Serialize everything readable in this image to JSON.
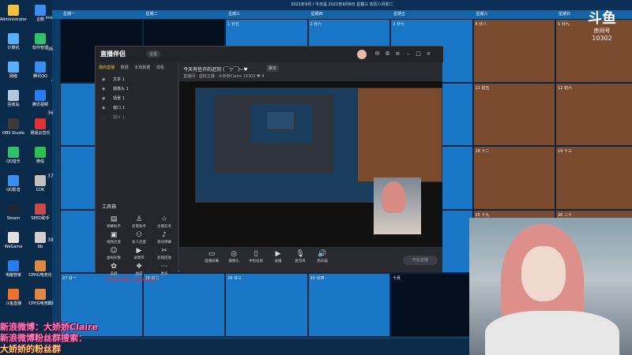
{
  "desktop_icons": [
    {
      "label": "Administrator",
      "color": "#f0c040"
    },
    {
      "label": "企鹅",
      "color": "#3b8df0"
    },
    {
      "label": "计算机",
      "color": "#5ab0ff"
    },
    {
      "label": "软件管理",
      "color": "#33c06a"
    },
    {
      "label": "网络",
      "color": "#5ab0ff"
    },
    {
      "label": "腾讯QQ",
      "color": "#3b8df0"
    },
    {
      "label": "回收站",
      "color": "#b0c8e0"
    },
    {
      "label": "腾讯视频",
      "color": "#2a7bf0"
    },
    {
      "label": "OBS Studio",
      "color": "#3a3a3a"
    },
    {
      "label": "网易云音乐",
      "color": "#d33"
    },
    {
      "label": "QQ音乐",
      "color": "#33c06a"
    },
    {
      "label": "微信",
      "color": "#2fbf55"
    },
    {
      "label": "QQ影音",
      "color": "#3b8df0"
    },
    {
      "label": "CDK",
      "color": "#c0c0c0"
    },
    {
      "label": "Steam",
      "color": "#1b2838"
    },
    {
      "label": "SEED助手",
      "color": "#c84a4a"
    },
    {
      "label": "WeGame",
      "color": "#e0e0e0"
    },
    {
      "label": "bb",
      "color": "#d0d0d0"
    },
    {
      "label": "电脑管家",
      "color": "#2a7bf0"
    },
    {
      "label": "CPHG电竞化",
      "color": "#d84"
    },
    {
      "label": "斗鱼直播",
      "color": "#f07030"
    },
    {
      "label": "CPHG电竞化",
      "color": "#d84"
    }
  ],
  "desktop_icons2": [
    {
      "label": "Internet Explorer",
      "color": "#3b8df0"
    },
    {
      "label": "LABELPRINT",
      "color": "#3a6ac0"
    },
    {
      "label": "Office2007",
      "color": "#d04a2a"
    },
    {
      "label": "QQ浏览器",
      "color": "#3b8df0"
    },
    {
      "label": "QQ游戏",
      "color": "#3b8df0"
    },
    {
      "label": "YY开播",
      "color": "#f0c040"
    },
    {
      "label": "小火箭",
      "color": "#f07030"
    },
    {
      "label": "网络上传",
      "color": "#5ab0ff"
    },
    {
      "label": "虎牙直播",
      "color": "#f0c040"
    },
    {
      "label": "直播伴侣",
      "color": "#d04a2a"
    }
  ],
  "calendar": {
    "topbar": "2021年9月 / 今天是 2021年9月8日 星期三 农历八月初二",
    "weekdays": [
      "星期一",
      "星期二",
      "星期三",
      "星期四",
      "星期五",
      "星期六",
      "星期日"
    ],
    "row_labels": [
      "35",
      "36",
      "37",
      "38",
      "39"
    ],
    "cells": [
      {
        "row": 0,
        "col": 2,
        "text": "1 廿五"
      },
      {
        "row": 0,
        "col": 3,
        "text": "2 廿六"
      },
      {
        "row": 0,
        "col": 4,
        "text": "3 廿七"
      },
      {
        "row": 0,
        "col": 5,
        "text": "4 廿八"
      },
      {
        "row": 0,
        "col": 6,
        "text": "5 廿九"
      },
      {
        "row": 1,
        "col": 5,
        "text": "11 初五"
      },
      {
        "row": 1,
        "col": 6,
        "text": "12 初六"
      },
      {
        "row": 2,
        "col": 5,
        "text": "18 十二"
      },
      {
        "row": 2,
        "col": 6,
        "text": "19 十三"
      },
      {
        "row": 3,
        "col": 5,
        "text": "25 十九"
      },
      {
        "row": 3,
        "col": 6,
        "text": "26 二十"
      },
      {
        "row": 4,
        "col": 0,
        "text": "27 廿一"
      },
      {
        "row": 4,
        "col": 1,
        "text": "28 廿二"
      },
      {
        "row": 4,
        "col": 2,
        "text": "29 廿三"
      },
      {
        "row": 4,
        "col": 3,
        "text": "30 廿四"
      },
      {
        "row": 4,
        "col": 4,
        "text": "十月"
      }
    ]
  },
  "room": {
    "logo": "斗鱼",
    "label": "房间号",
    "number": "10302"
  },
  "app": {
    "name": "直播伴侣",
    "version": "设置",
    "left_tabs": [
      "我的直播",
      "数据",
      "本场数据",
      "观看"
    ],
    "scenes": [
      "文本 1",
      "摄像头 1",
      "场景 1",
      "窗口 1",
      "图片 1"
    ],
    "tools_title": "工具箱",
    "tools": [
      "弹幕助手",
      "房管助手",
      "主播任务",
      "视频连麦",
      "多人连麦",
      "歌词弹幕",
      "虚拟形象",
      "录像带",
      "剪辑回放",
      "美颜",
      "福袋",
      "更多"
    ],
    "footer_note": "如何更好的吸引粉丝观看直播？",
    "stream_title": "今天有些许的迟到 (￣▽￣)~♥",
    "stream_tag": "聊天",
    "stream_meta": "直播间 · 虚拟主播 · 大娇娇Claire   10302   ♥ 4",
    "controls": [
      "直播屏幕",
      "摄像头",
      "手机投屏",
      "录播",
      "麦克风",
      "扬声器"
    ],
    "start_live": "开始直播"
  },
  "overlay": {
    "line1": "新浪微博：大娇娇Claire",
    "line2": "新浪微博粉丝群搜索：",
    "line3": "大娇娇的粉丝群"
  }
}
